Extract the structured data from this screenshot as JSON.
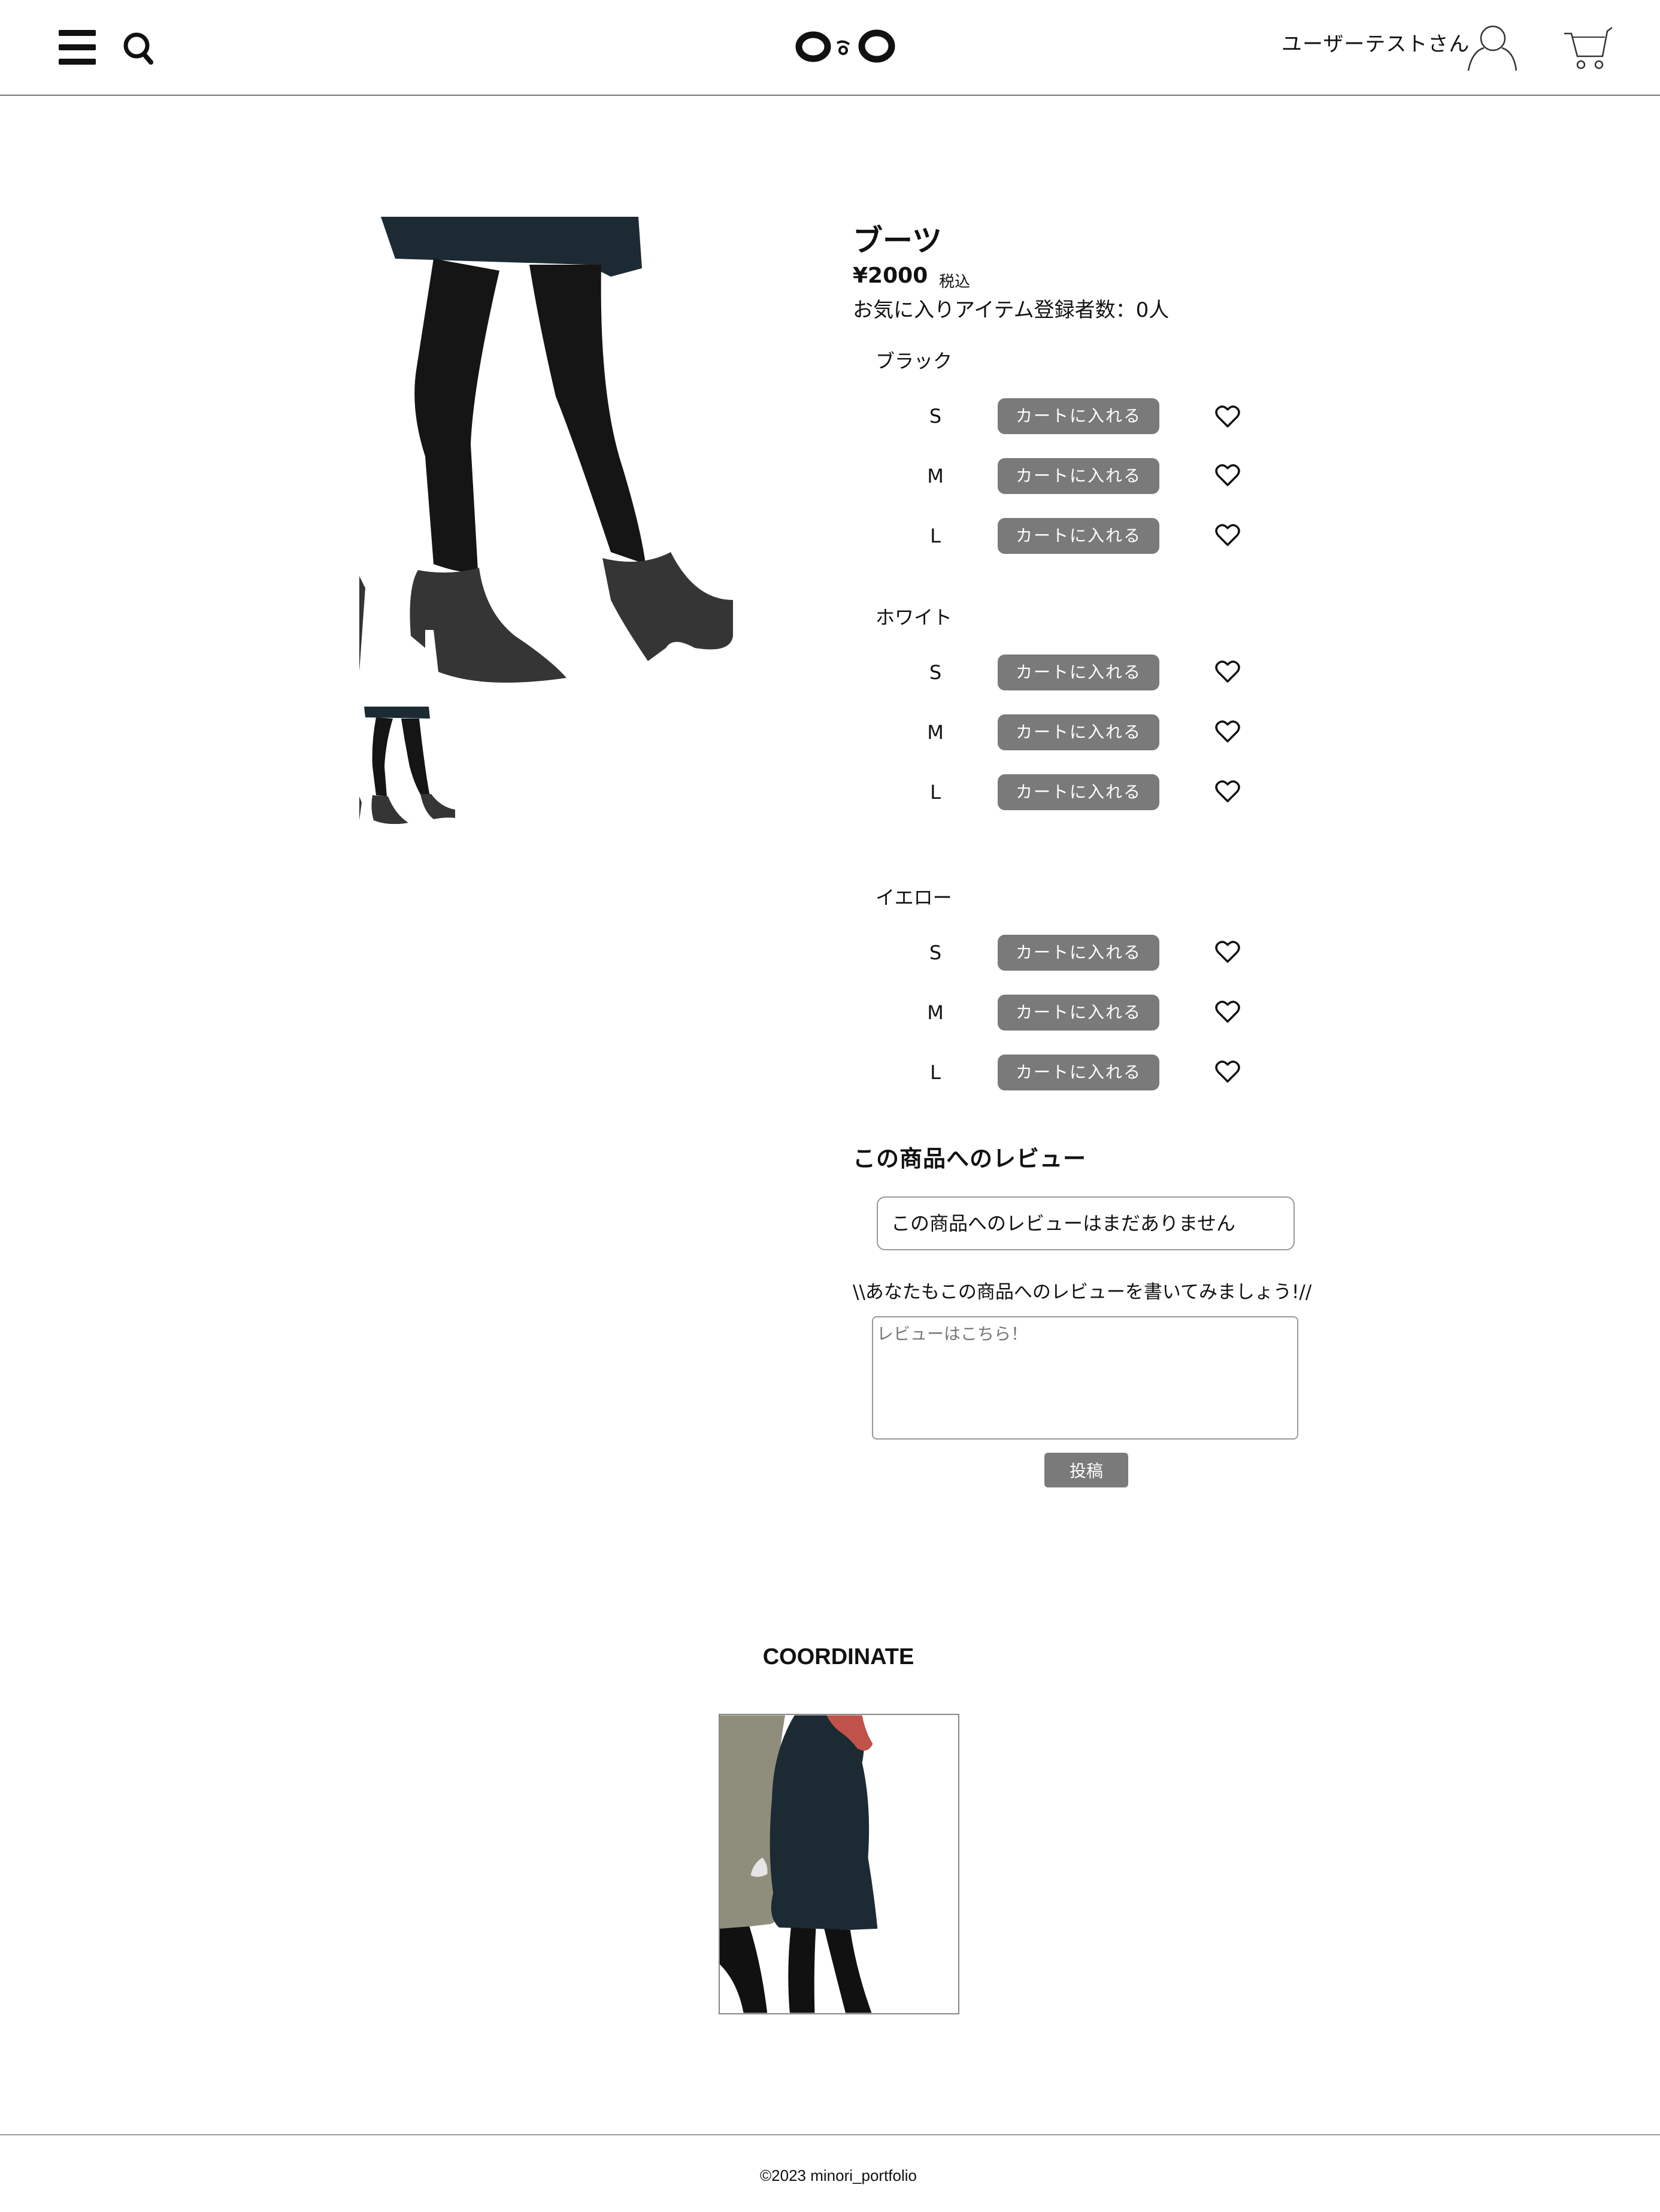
{
  "header": {
    "username": "ユーザーテストさん"
  },
  "product": {
    "title": "ブーツ",
    "price": "¥2000",
    "tax_label": "税込",
    "favorite_count": "お気に入りアイテム登録者数：0人",
    "variants": [
      {
        "color": "ブラック",
        "sizes": [
          "S",
          "M",
          "L"
        ]
      },
      {
        "color": "ホワイト",
        "sizes": [
          "S",
          "M",
          "L"
        ]
      },
      {
        "color": "イエロー",
        "sizes": [
          "S",
          "M",
          "L"
        ]
      }
    ],
    "add_to_cart_label": "カートに入れる"
  },
  "reviews": {
    "heading": "この商品へのレビュー",
    "empty_message": "この商品へのレビューはまだありません",
    "invite": "\\\\あなたもこの商品へのレビューを書いてみましょう!//",
    "input_placeholder": "レビューはこちら！",
    "submit_label": "投稿"
  },
  "coordinate": {
    "title": "COORDINATE"
  },
  "footer": {
    "copyright": "©2023 minori_portfolio"
  },
  "icons": [
    "menu-icon",
    "search-icon",
    "logo",
    "user-icon",
    "cart-icon",
    "heart-icon"
  ]
}
